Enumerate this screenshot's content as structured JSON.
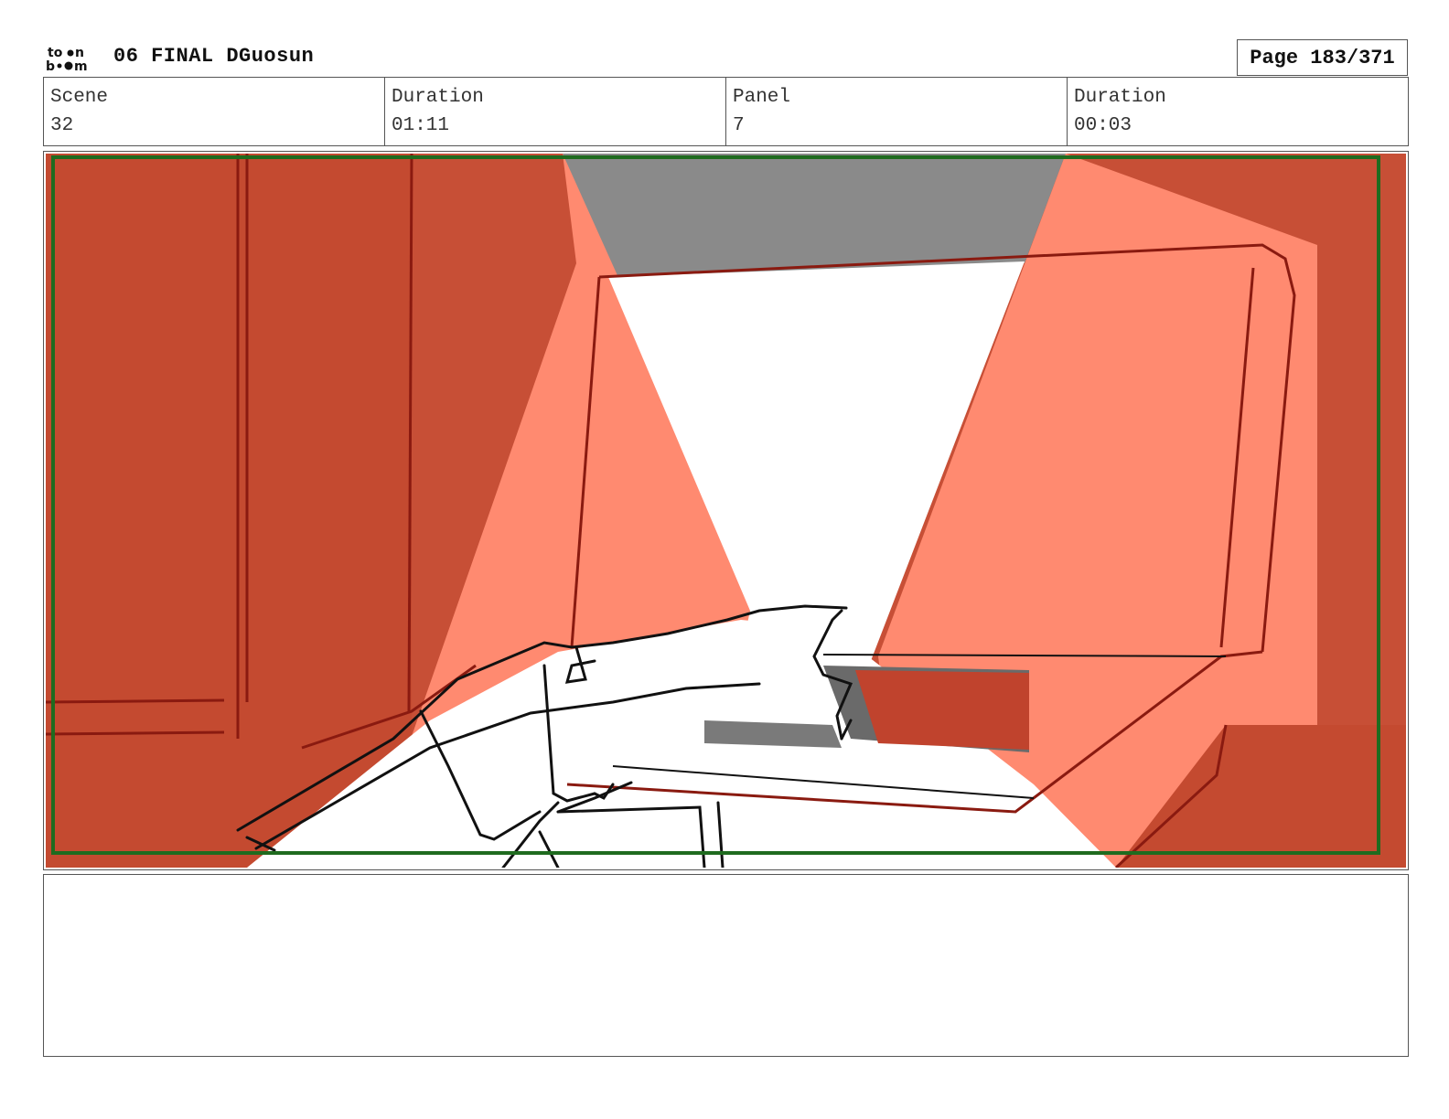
{
  "header": {
    "logo_text": "toon boom",
    "project_title": "06 FINAL DGuosun",
    "page_label": "Page 183/371"
  },
  "info": {
    "scene_label": "Scene",
    "scene_value": "32",
    "scene_duration_label": "Duration",
    "scene_duration_value": "01:11",
    "panel_label": "Panel",
    "panel_value": "7",
    "panel_duration_label": "Duration",
    "panel_duration_value": "00:03"
  },
  "colors": {
    "bg_red": "#c44a30",
    "light_red": "#ff8a70",
    "gray_ceiling": "#8a8a8a",
    "safe_frame_green": "#1f6b1f",
    "line_dark_red": "#8a1a10"
  },
  "notes": {
    "text": ""
  }
}
